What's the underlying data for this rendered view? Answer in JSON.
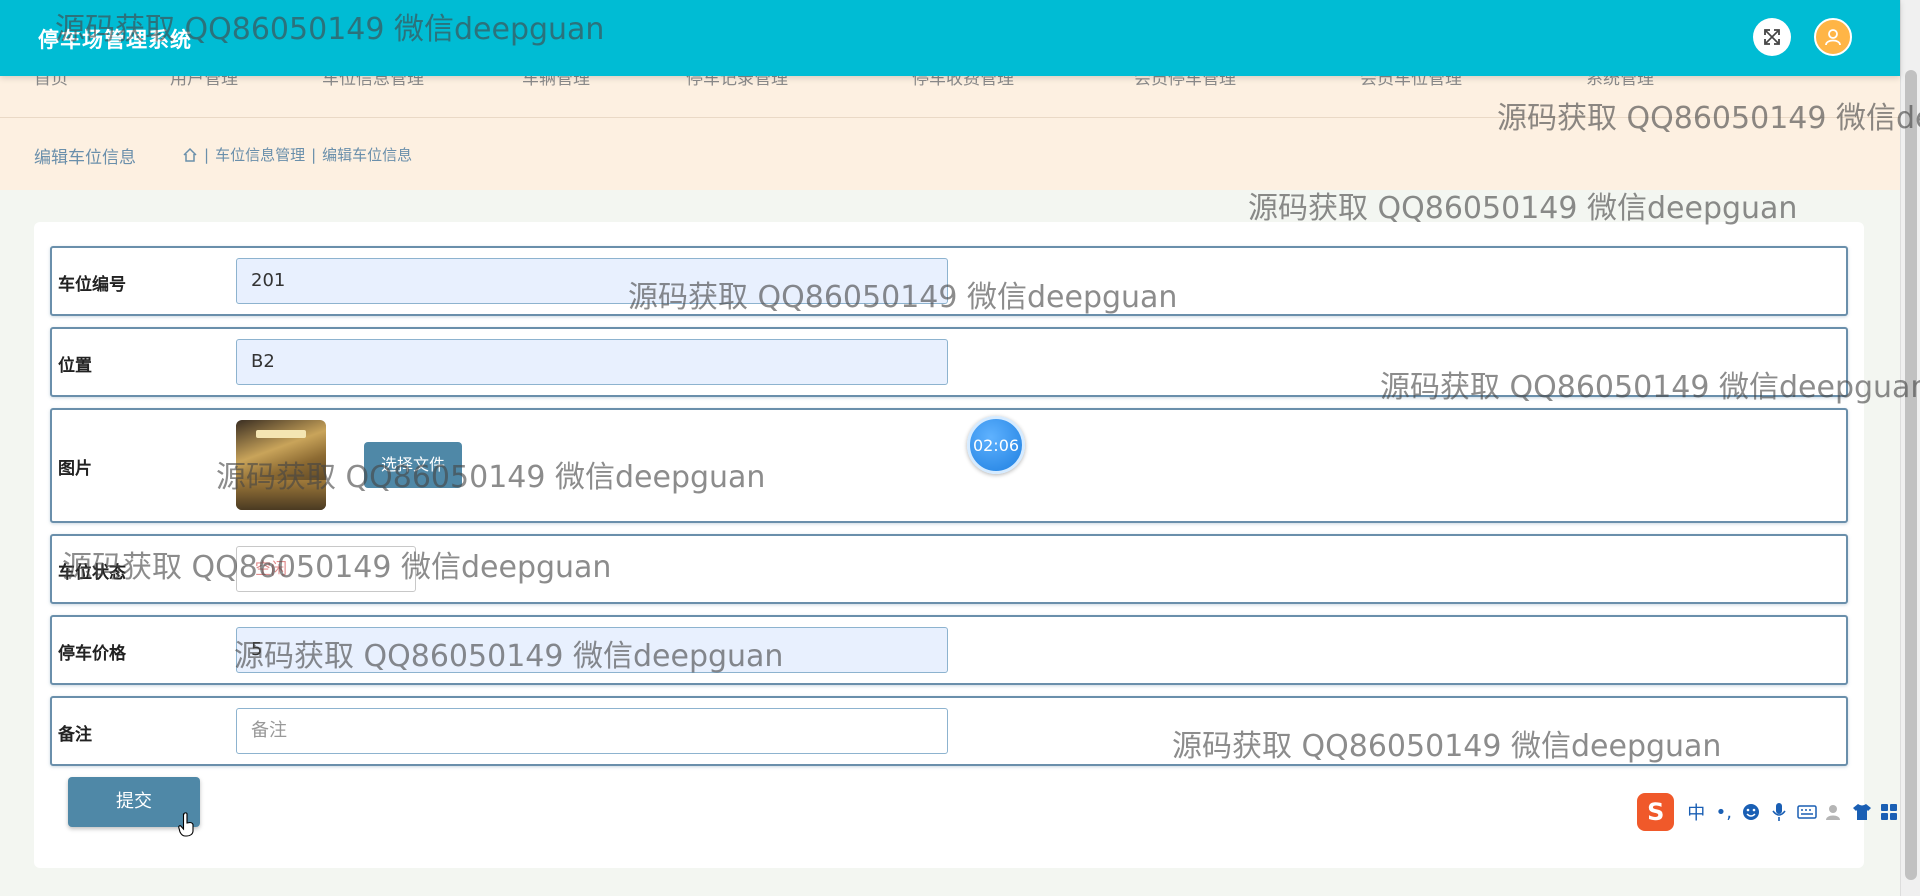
{
  "app": {
    "title": "停车场管理系统"
  },
  "header": {
    "fullscreen_icon": "expand-icon",
    "user_icon": "user-avatar-icon"
  },
  "nav": {
    "items": [
      "首页",
      "用户管理",
      "车位信息管理",
      "车辆管理",
      "停车记录管理",
      "停车收费管理",
      "会员停车管理",
      "会员车位管理",
      "系统管理"
    ]
  },
  "breadcrumb": {
    "page_title": "编辑车位信息",
    "home_icon": "home-icon",
    "separator": "|",
    "level1": "车位信息管理",
    "level2": "编辑车位信息"
  },
  "form": {
    "fields": {
      "space_number": {
        "label": "车位编号",
        "value": "201"
      },
      "location": {
        "label": "位置",
        "value": "B2"
      },
      "image": {
        "label": "图片",
        "button": "选择文件"
      },
      "status": {
        "label": "车位状态",
        "value": "空闲"
      },
      "price": {
        "label": "停车价格",
        "value": "5"
      },
      "remark": {
        "label": "备注",
        "placeholder": "备注"
      }
    },
    "submit_label": "提交"
  },
  "overlay": {
    "timer": "02:06",
    "watermark": "源码获取 QQ86050149 微信deepguan"
  },
  "ime": {
    "logo": "S",
    "mode": "中",
    "punct": "•,"
  },
  "colors": {
    "header": "#00bcd4",
    "accent": "#4f88a7",
    "band": "#fdf0e1",
    "avatar": "#ffb546"
  }
}
